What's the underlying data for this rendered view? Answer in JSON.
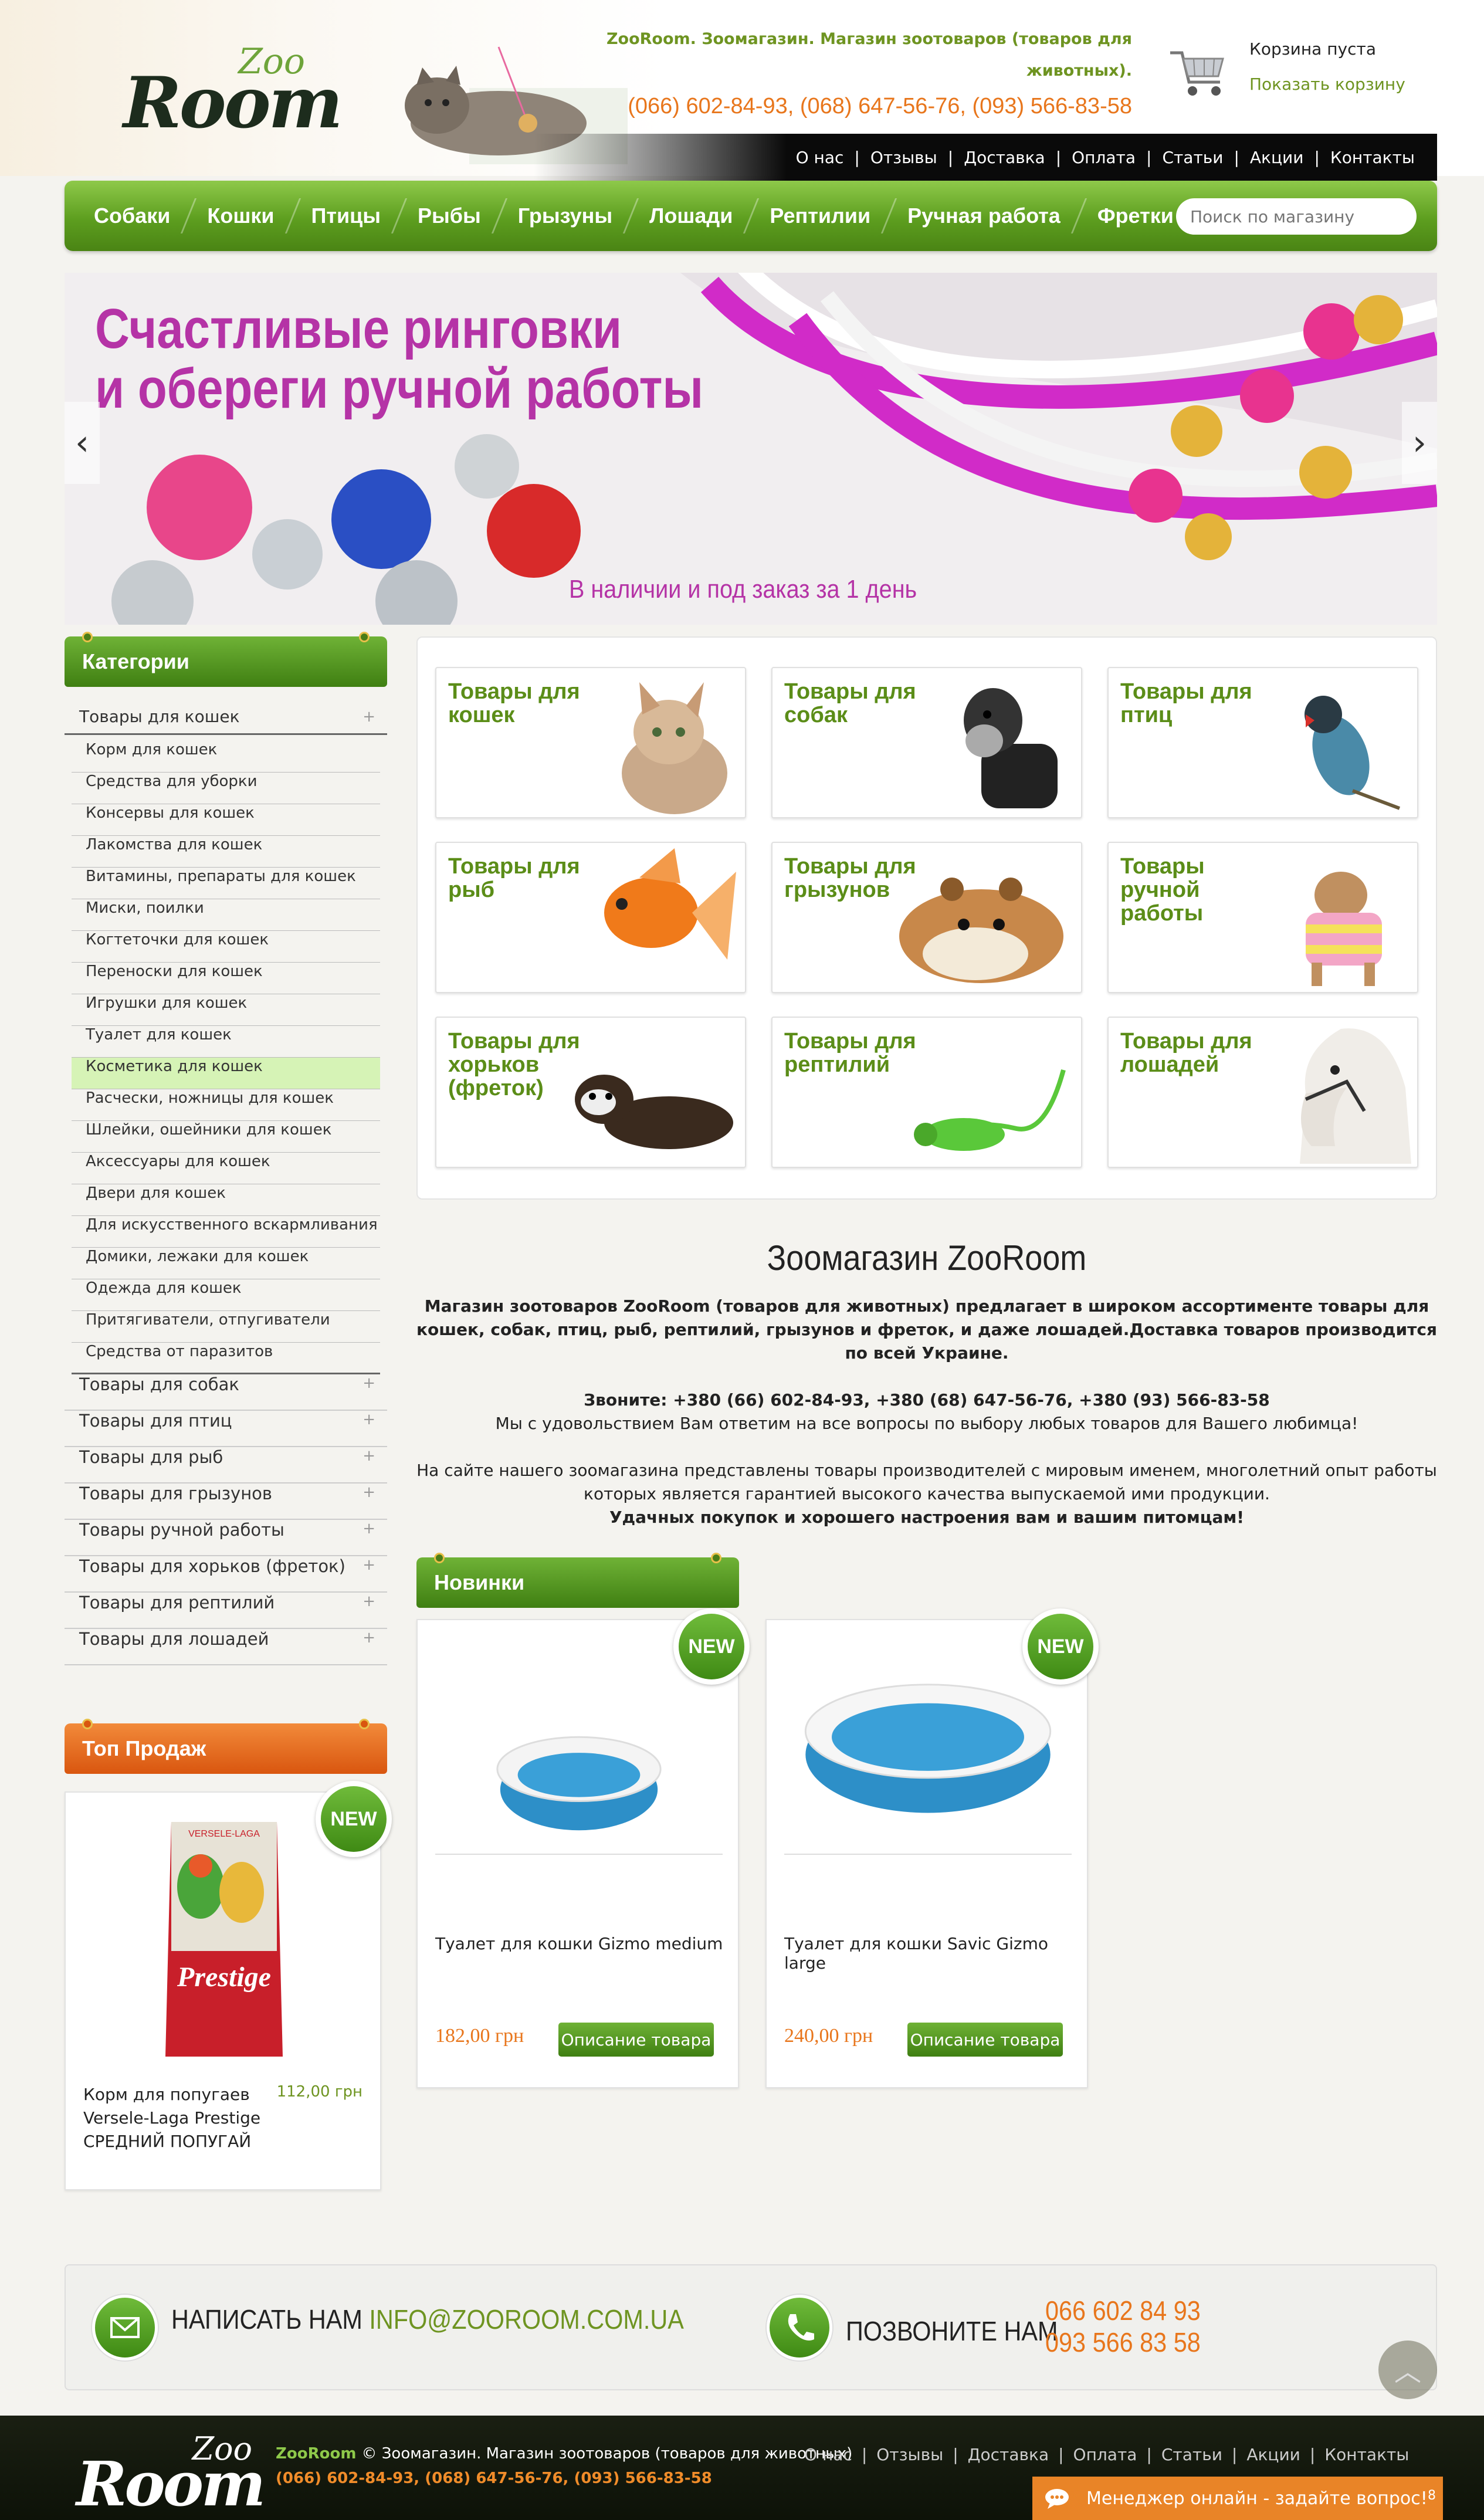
{
  "header": {
    "logo_zoo": "Zoo",
    "logo_room": "Room",
    "tagline": "ZooRoom. Зоомагазин. Магазин зоотоваров (товаров для животных).",
    "phones": "(066) 602-84-93, (068) 647-56-76, (093) 566-83-58",
    "cart_empty": "Корзина пуста",
    "cart_show": "Показать корзину"
  },
  "top_nav": [
    "О нас",
    "Отзывы",
    "Доставка",
    "Оплата",
    "Статьи",
    "Акции",
    "Контакты"
  ],
  "main_nav": [
    "Собаки",
    "Кошки",
    "Птицы",
    "Рыбы",
    "Грызуны",
    "Лошади",
    "Рептилии",
    "Ручная работа",
    "Фретки"
  ],
  "search": {
    "placeholder": "Поиск по магазину"
  },
  "slider": {
    "title_line1": "Счастливые ринговки",
    "title_line2": "и обереги ручной работы",
    "subtitle": "В наличии и под заказ за 1 день",
    "prev": "‹",
    "next": "›"
  },
  "sidebar": {
    "categories_title": "Категории",
    "open_category": "Товары для кошек",
    "subcategories": [
      "Корм для кошек",
      "Средства для уборки",
      "Консервы для кошек",
      "Лакомства для кошек",
      "Витамины, препараты для кошек",
      "Миски, поилки",
      "Когтеточки для кошек",
      "Переноски для кошек",
      "Игрушки для кошек",
      "Туалет для кошек",
      "Косметика для кошек",
      "Расчески, ножницы для кошек",
      "Шлейки, ошейники для кошек",
      "Аксессуары для кошек",
      "Двери для кошек",
      "Для искусственного вскармливания",
      "Домики, лежаки для кошек",
      "Одежда для кошек",
      "Притягиватели, отпугиватели",
      "Средства от паразитов"
    ],
    "categories": [
      "Товары для собак",
      "Товары для птиц",
      "Товары для рыб",
      "Товары для грызунов",
      "Товары ручной работы",
      "Товары для хорьков (фреток)",
      "Товары для рептилий",
      "Товары для лошадей"
    ],
    "plus": "+",
    "top_sales_title": "Топ Продаж",
    "top_product": {
      "badge": "NEW",
      "name": "Корм для попугаев Versele-Laga Prestige СРЕДНИЙ ПОПУГАЙ",
      "price": "112,00 грн",
      "pack_brand": "VERSELE-LAGA",
      "pack_label": "Prestige"
    }
  },
  "tiles": [
    "Товары для кошек",
    "Товары для собак",
    "Товары для птиц",
    "Товары для рыб",
    "Товары для грызунов",
    "Товары ручной работы",
    "Товары для хорьков (фреток)",
    "Товары для рептилий",
    "Товары для лошадей"
  ],
  "about": {
    "title": "Зоомагазин ZooRoom",
    "p1": "Магазин зоотоваров ZooRoom (товаров для животных) предлагает в широком ассортименте товары для кошек, собак, птиц, рыб, рептилий, грызунов и фреток, и даже лошадей.Доставка товаров производится по всей Украине.",
    "p2": "Звоните: +380 (66) 602-84-93, +380 (68) 647-56-76, +380 (93) 566-83-58",
    "p3": "Мы с удовольствием Вам ответим на все вопросы по выбору любых товаров для Вашего любимца!",
    "p4": "На сайте нашего зоомагазина представлены товары производителей с мировым именем, многолетний опыт работы которых является гарантией высокого качества выпускаемой ими продукции.",
    "p5": "Удачных покупок и хорошего настроения вам и вашим питомцам!"
  },
  "novinki": {
    "title": "Новинки",
    "products": [
      {
        "badge": "NEW",
        "name": "Туалет для кошки Gizmo medium",
        "price": "182,00 грн",
        "button": "Описание товара"
      },
      {
        "badge": "NEW",
        "name": "Туалет для кошки Savic Gizmo large",
        "price": "240,00 грн",
        "button": "Описание товара"
      }
    ]
  },
  "contact": {
    "write_label": "НАПИСАТЬ НАМ",
    "email": "INFO@ZOOROOM.COM.UA",
    "call_label": "ПОЗВОНИТЕ НАМ",
    "phone1": "066 602 84 93",
    "phone2": "093 566 83 58"
  },
  "footer": {
    "logo_zoo": "Zoo",
    "logo_room": "Room",
    "brand": "ZooRoom",
    "copyright": "© Зоомагазин. Магазин зоотоваров (товаров для животных)",
    "phones": "(066) 602-84-93, (068) 647-56-76, (093) 566-83-58",
    "nav": [
      "О нас",
      "Отзывы",
      "Доставка",
      "Оплата",
      "Статьи",
      "Акции",
      "Контакты"
    ],
    "to_top": "︿",
    "chat_label": "Менеджер онлайн - задайте вопрос!",
    "chat_count": "8"
  },
  "colors": {
    "green": "#5d9e1f",
    "orange": "#e8761c",
    "magenta": "#b533a6"
  }
}
